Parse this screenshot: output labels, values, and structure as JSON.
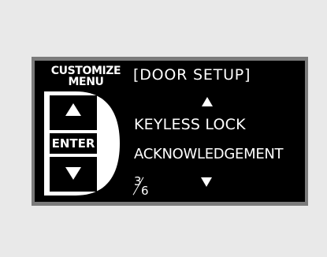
{
  "customize_menu": {
    "title_line1": "CUSTOMIZE",
    "title_line2": "MENU",
    "enter_label": "ENTER",
    "up_button_icon": "triangle-up-icon",
    "down_button_icon": "triangle-down-icon"
  },
  "display": {
    "header": "[DOOR SETUP]",
    "item_line1": "KEYLESS LOCK",
    "item_line2": "ACKNOWLEDGEMENT",
    "page_current": "3",
    "page_total": "6",
    "scroll_up_icon": "triangle-up-icon",
    "scroll_down_icon": "triangle-down-icon"
  },
  "colors": {
    "background": "#e9e9e9",
    "frame": "#7b7b7b",
    "screen": "#000000",
    "text": "#ffffff"
  }
}
